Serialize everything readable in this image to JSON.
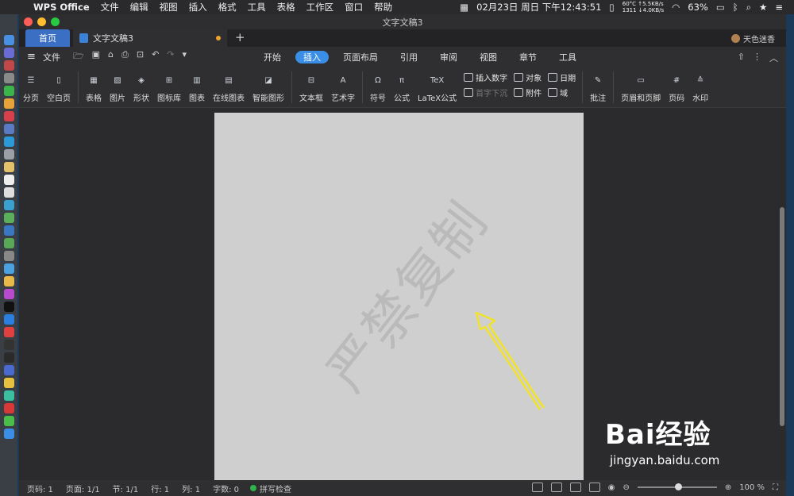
{
  "menubar": {
    "app_name": "WPS Office",
    "items": [
      "文件",
      "编辑",
      "视图",
      "插入",
      "格式",
      "工具",
      "表格",
      "工作区",
      "窗口",
      "帮助"
    ],
    "datetime": "02月23日 周日 下午12:43:51",
    "temp": "60°C",
    "fan": "1311",
    "net_up": "↑5.5KB/s",
    "net_down": "↓4.0KB/s",
    "battery": "63%"
  },
  "window": {
    "title": "文字文稿3"
  },
  "tabs": {
    "home": "首页",
    "doc": "文字文稿3",
    "add": "+"
  },
  "user": {
    "name": "天色迷香"
  },
  "menu": {
    "file": "文件",
    "ribbon_tabs": [
      "开始",
      "插入",
      "页面布局",
      "引用",
      "审阅",
      "视图",
      "章节",
      "工具"
    ],
    "active_tab": "插入"
  },
  "toolbar": {
    "page_break": "分页",
    "blank_page": "空白页",
    "table": "表格",
    "picture": "图片",
    "shape": "形状",
    "icon_lib": "图标库",
    "chart": "图表",
    "online_chart": "在线图表",
    "smart_shape": "智能图形",
    "textbox": "文本框",
    "wordart": "艺术字",
    "symbol": "符号",
    "formula": "公式",
    "latex": "LaTeX公式",
    "insert_number": "插入数字",
    "drop_cap": "首字下沉",
    "object": "对象",
    "attachment": "附件",
    "date": "日期",
    "field": "域",
    "comment": "批注",
    "header_footer": "页眉和页脚",
    "page_number": "页码",
    "watermark": "水印"
  },
  "document": {
    "watermark_text": "严禁复制"
  },
  "statusbar": {
    "page_num": "页码: 1",
    "pages": "页面: 1/1",
    "section": "节: 1/1",
    "line": "行: 1",
    "column": "列: 1",
    "word_count": "字数: 0",
    "spell_check": "拼写检查",
    "zoom": "100 %"
  },
  "overlay": {
    "brand": "Bai经验",
    "url": "jingyan.baidu.com"
  },
  "colors": {
    "accent": "#3a8ee6",
    "page": "#cfcfcf",
    "arrow": "#f2e32a"
  }
}
